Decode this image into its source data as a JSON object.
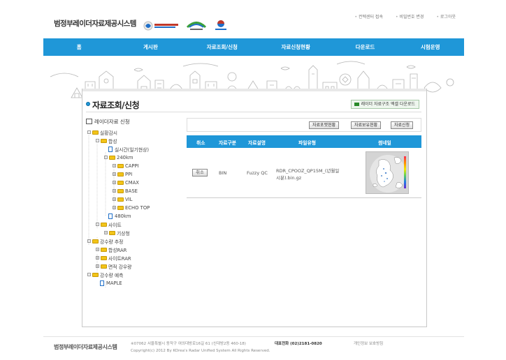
{
  "header": {
    "site_title": "범정부레이더자료제공시스템",
    "logos": [
      {
        "name": "한강홍수통제소 logo",
        "color": "#1f6fc8"
      },
      {
        "name": "국토교통부 logo",
        "color": "#3aa03a"
      },
      {
        "name": "기상청 logo",
        "color": "#1f6fc8"
      }
    ],
    "util_links": [
      "컨텍센터 접속",
      "비밀번호 변경",
      "로그아웃"
    ]
  },
  "nav": {
    "items": [
      "홈",
      "게시판",
      "자료조회/신청",
      "자료신청현황",
      "다운로드",
      "시험운영"
    ]
  },
  "content": {
    "page_title": "자료조회/신청",
    "struct_button": "레이더 자료구조 엑셀 다운로드",
    "tree_heading": "레이더자료 신청",
    "tree": [
      {
        "label": "실황감시",
        "type": "folder"
      },
      {
        "label": "합성",
        "type": "folder"
      },
      {
        "label": "실시간(일기현상)",
        "type": "doc"
      },
      {
        "label": "240km",
        "type": "folder"
      },
      {
        "label": "CAPPI",
        "type": "folder"
      },
      {
        "label": "PPI",
        "type": "folder"
      },
      {
        "label": "CMAX",
        "type": "folder"
      },
      {
        "label": "BASE",
        "type": "folder"
      },
      {
        "label": "VIL",
        "type": "folder"
      },
      {
        "label": "ECHO TOP",
        "type": "folder"
      },
      {
        "label": "480km",
        "type": "doc"
      },
      {
        "label": "사이트",
        "type": "folder"
      },
      {
        "label": "기상청",
        "type": "folder"
      },
      {
        "label": "강수량 추정",
        "type": "folder"
      },
      {
        "label": "합성RAR",
        "type": "folder"
      },
      {
        "label": "사이트RAR",
        "type": "folder"
      },
      {
        "label": "면적 강우량",
        "type": "folder"
      },
      {
        "label": "강수량 예측",
        "type": "folder"
      },
      {
        "label": "MAPLE",
        "type": "doc"
      }
    ],
    "actions": [
      "자료포맷현황",
      "자료보유현황",
      "자료신청"
    ],
    "table_headers": [
      "취소",
      "자료구분",
      "자료설명",
      "파일유형",
      "썸네일"
    ],
    "row": {
      "cancel": "취소",
      "kind": "BIN",
      "desc": "Fuzzy QC",
      "file_line1": "RDR_CPOOZ_QP15M_(년월일",
      "file_line2": "시분).bin.gz"
    }
  },
  "footer": {
    "title": "범정부레이더자료제공시스템",
    "address": "※07062 서울특별시 동작구 여의대방로16길 61 (신대방2동 460-18)",
    "phone": "대표전화 (02)2181-0820",
    "privacy": "개인정보 보호방침",
    "copyright": "Copyright(c) 2012 By KOrea's Radar Unified System All Rights Reserved."
  }
}
